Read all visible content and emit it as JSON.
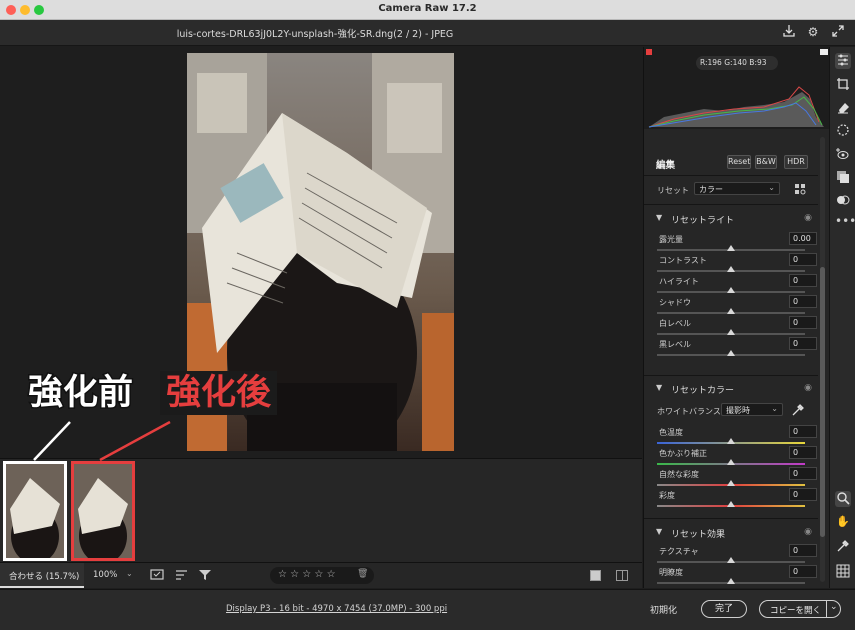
{
  "window": {
    "title": "Camera Raw 17.2",
    "file_title": "luis-cortes-DRL63jJ0L2Y-unsplash-強化-SR.dng(2 / 2)  -  JPEG"
  },
  "histogram": {
    "r_label": "R:",
    "r": "196",
    "g_label": "G:",
    "g": "140",
    "b_label": "B:",
    "b": "93"
  },
  "panel": {
    "title": "編集",
    "buttons": {
      "reset": "Reset",
      "bw": "B&W",
      "hdr": "HDR"
    },
    "preset_label": "リセット",
    "profile_value": "カラー",
    "sections": {
      "light": {
        "title": "リセットライト",
        "sliders": [
          {
            "label": "露光量",
            "value": "0.00",
            "pos": 0.5
          },
          {
            "label": "コントラスト",
            "value": "0",
            "pos": 0.5
          },
          {
            "label": "ハイライト",
            "value": "0",
            "pos": 0.5
          },
          {
            "label": "シャドウ",
            "value": "0",
            "pos": 0.5
          },
          {
            "label": "白レベル",
            "value": "0",
            "pos": 0.5
          },
          {
            "label": "黒レベル",
            "value": "0",
            "pos": 0.5
          }
        ]
      },
      "color": {
        "title": "リセットカラー",
        "wb_label": "ホワイトバランス",
        "wb_value": "撮影時",
        "sliders": [
          {
            "label": "色温度",
            "value": "0",
            "pos": 0.5
          },
          {
            "label": "色かぶり補正",
            "value": "0",
            "pos": 0.5
          },
          {
            "label": "自然な彩度",
            "value": "0",
            "pos": 0.5
          },
          {
            "label": "彩度",
            "value": "0",
            "pos": 0.5
          }
        ]
      },
      "effects": {
        "title": "リセット効果",
        "sliders": [
          {
            "label": "テクスチャ",
            "value": "0",
            "pos": 0.5
          },
          {
            "label": "明瞭度",
            "value": "0",
            "pos": 0.5
          }
        ]
      }
    }
  },
  "annotations": {
    "before": "強化前",
    "after": "強化後"
  },
  "toolbar": {
    "fit": "合わせる (15.7%)",
    "zoom": "100%",
    "stars": "☆ ☆ ☆ ☆ ☆"
  },
  "status": {
    "info": "Display P3 - 16 bit - 4970 x 7454 (37.0MP) - 300 ppi",
    "init": "初期化",
    "done": "完了",
    "copy_open": "コピーを開く"
  },
  "colors": {
    "accent_red": "#e53e3e",
    "panel_bg": "#262626"
  }
}
